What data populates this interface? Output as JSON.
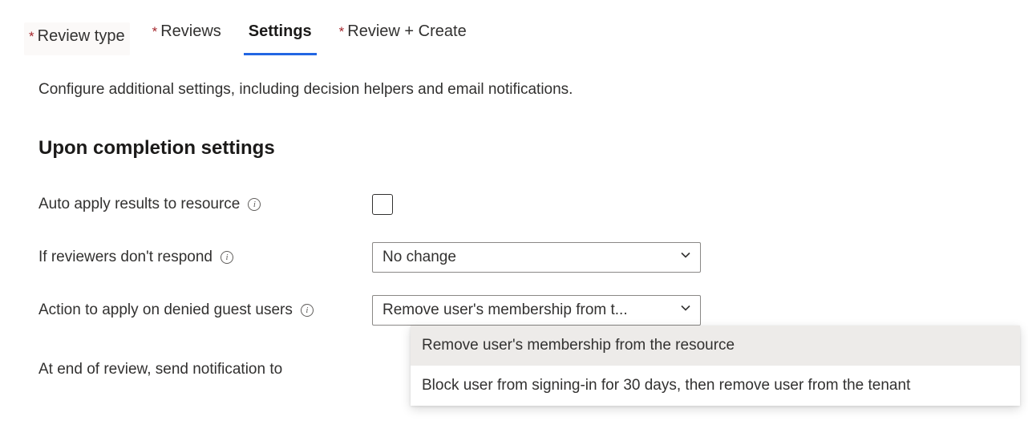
{
  "tabs": {
    "review_type": "Review type",
    "reviews": "Reviews",
    "settings": "Settings",
    "review_create": "Review + Create"
  },
  "description": "Configure additional settings, including decision helpers and email notifications.",
  "section_title": "Upon completion settings",
  "rows": {
    "auto_apply": {
      "label": "Auto apply results to resource"
    },
    "no_respond": {
      "label": "If reviewers don't respond",
      "selected": "No change"
    },
    "denied_guest": {
      "label": "Action to apply on denied guest users",
      "selected": "Remove user's membership from t...",
      "options": {
        "opt1": "Remove user's membership from the resource",
        "opt2": "Block user from signing-in for 30 days, then remove user from the tenant"
      }
    },
    "notification": {
      "label": "At end of review, send notification to"
    }
  }
}
